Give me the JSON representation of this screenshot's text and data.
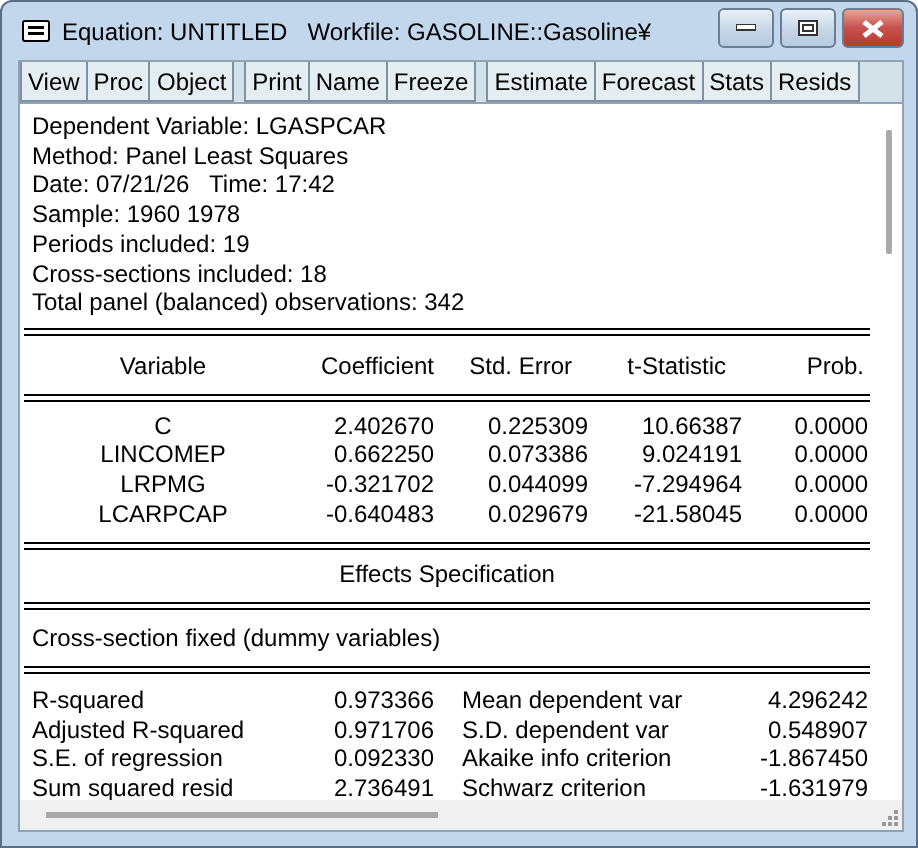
{
  "window": {
    "title": "Equation: UNTITLED",
    "workfile": "Workfile: GASOLINE::Gasoline¥"
  },
  "toolbar": [
    [
      "View",
      "Proc",
      "Object"
    ],
    [
      "Print",
      "Name",
      "Freeze"
    ],
    [
      "Estimate",
      "Forecast",
      "Stats",
      "Resids"
    ]
  ],
  "header_lines": [
    "Dependent Variable: LGASPCAR",
    "Method: Panel Least Squares",
    "Date: 07/21/26   Time: 17:42",
    "Sample: 1960 1978",
    "Periods included: 19",
    "Cross-sections included: 18",
    "Total panel (balanced) observations: 342"
  ],
  "coefficients": {
    "columns": [
      "Variable",
      "Coefficient",
      "Std. Error",
      "t-Statistic",
      "Prob."
    ],
    "rows": [
      [
        "C",
        "2.402670",
        "0.225309",
        "10.66387",
        "0.0000"
      ],
      [
        "LINCOMEP",
        "0.662250",
        "0.073386",
        "9.024191",
        "0.0000"
      ],
      [
        "LRPMG",
        "-0.321702",
        "0.044099",
        "-7.294964",
        "0.0000"
      ],
      [
        "LCARPCAP",
        "-0.640483",
        "0.029679",
        "-21.58045",
        "0.0000"
      ]
    ]
  },
  "effects": {
    "title": "Effects Specification",
    "lines": [
      "Cross-section fixed (dummy variables)"
    ]
  },
  "statistics": [
    [
      "R-squared",
      "0.973366",
      "Mean dependent var",
      "4.296242"
    ],
    [
      "Adjusted R-squared",
      "0.971706",
      "S.D. dependent var",
      "0.548907"
    ],
    [
      "S.E. of regression",
      "0.092330",
      "Akaike info criterion",
      "-1.867450"
    ],
    [
      "Sum squared resid",
      "2.736491",
      "Schwarz criterion",
      "-1.631979"
    ]
  ]
}
